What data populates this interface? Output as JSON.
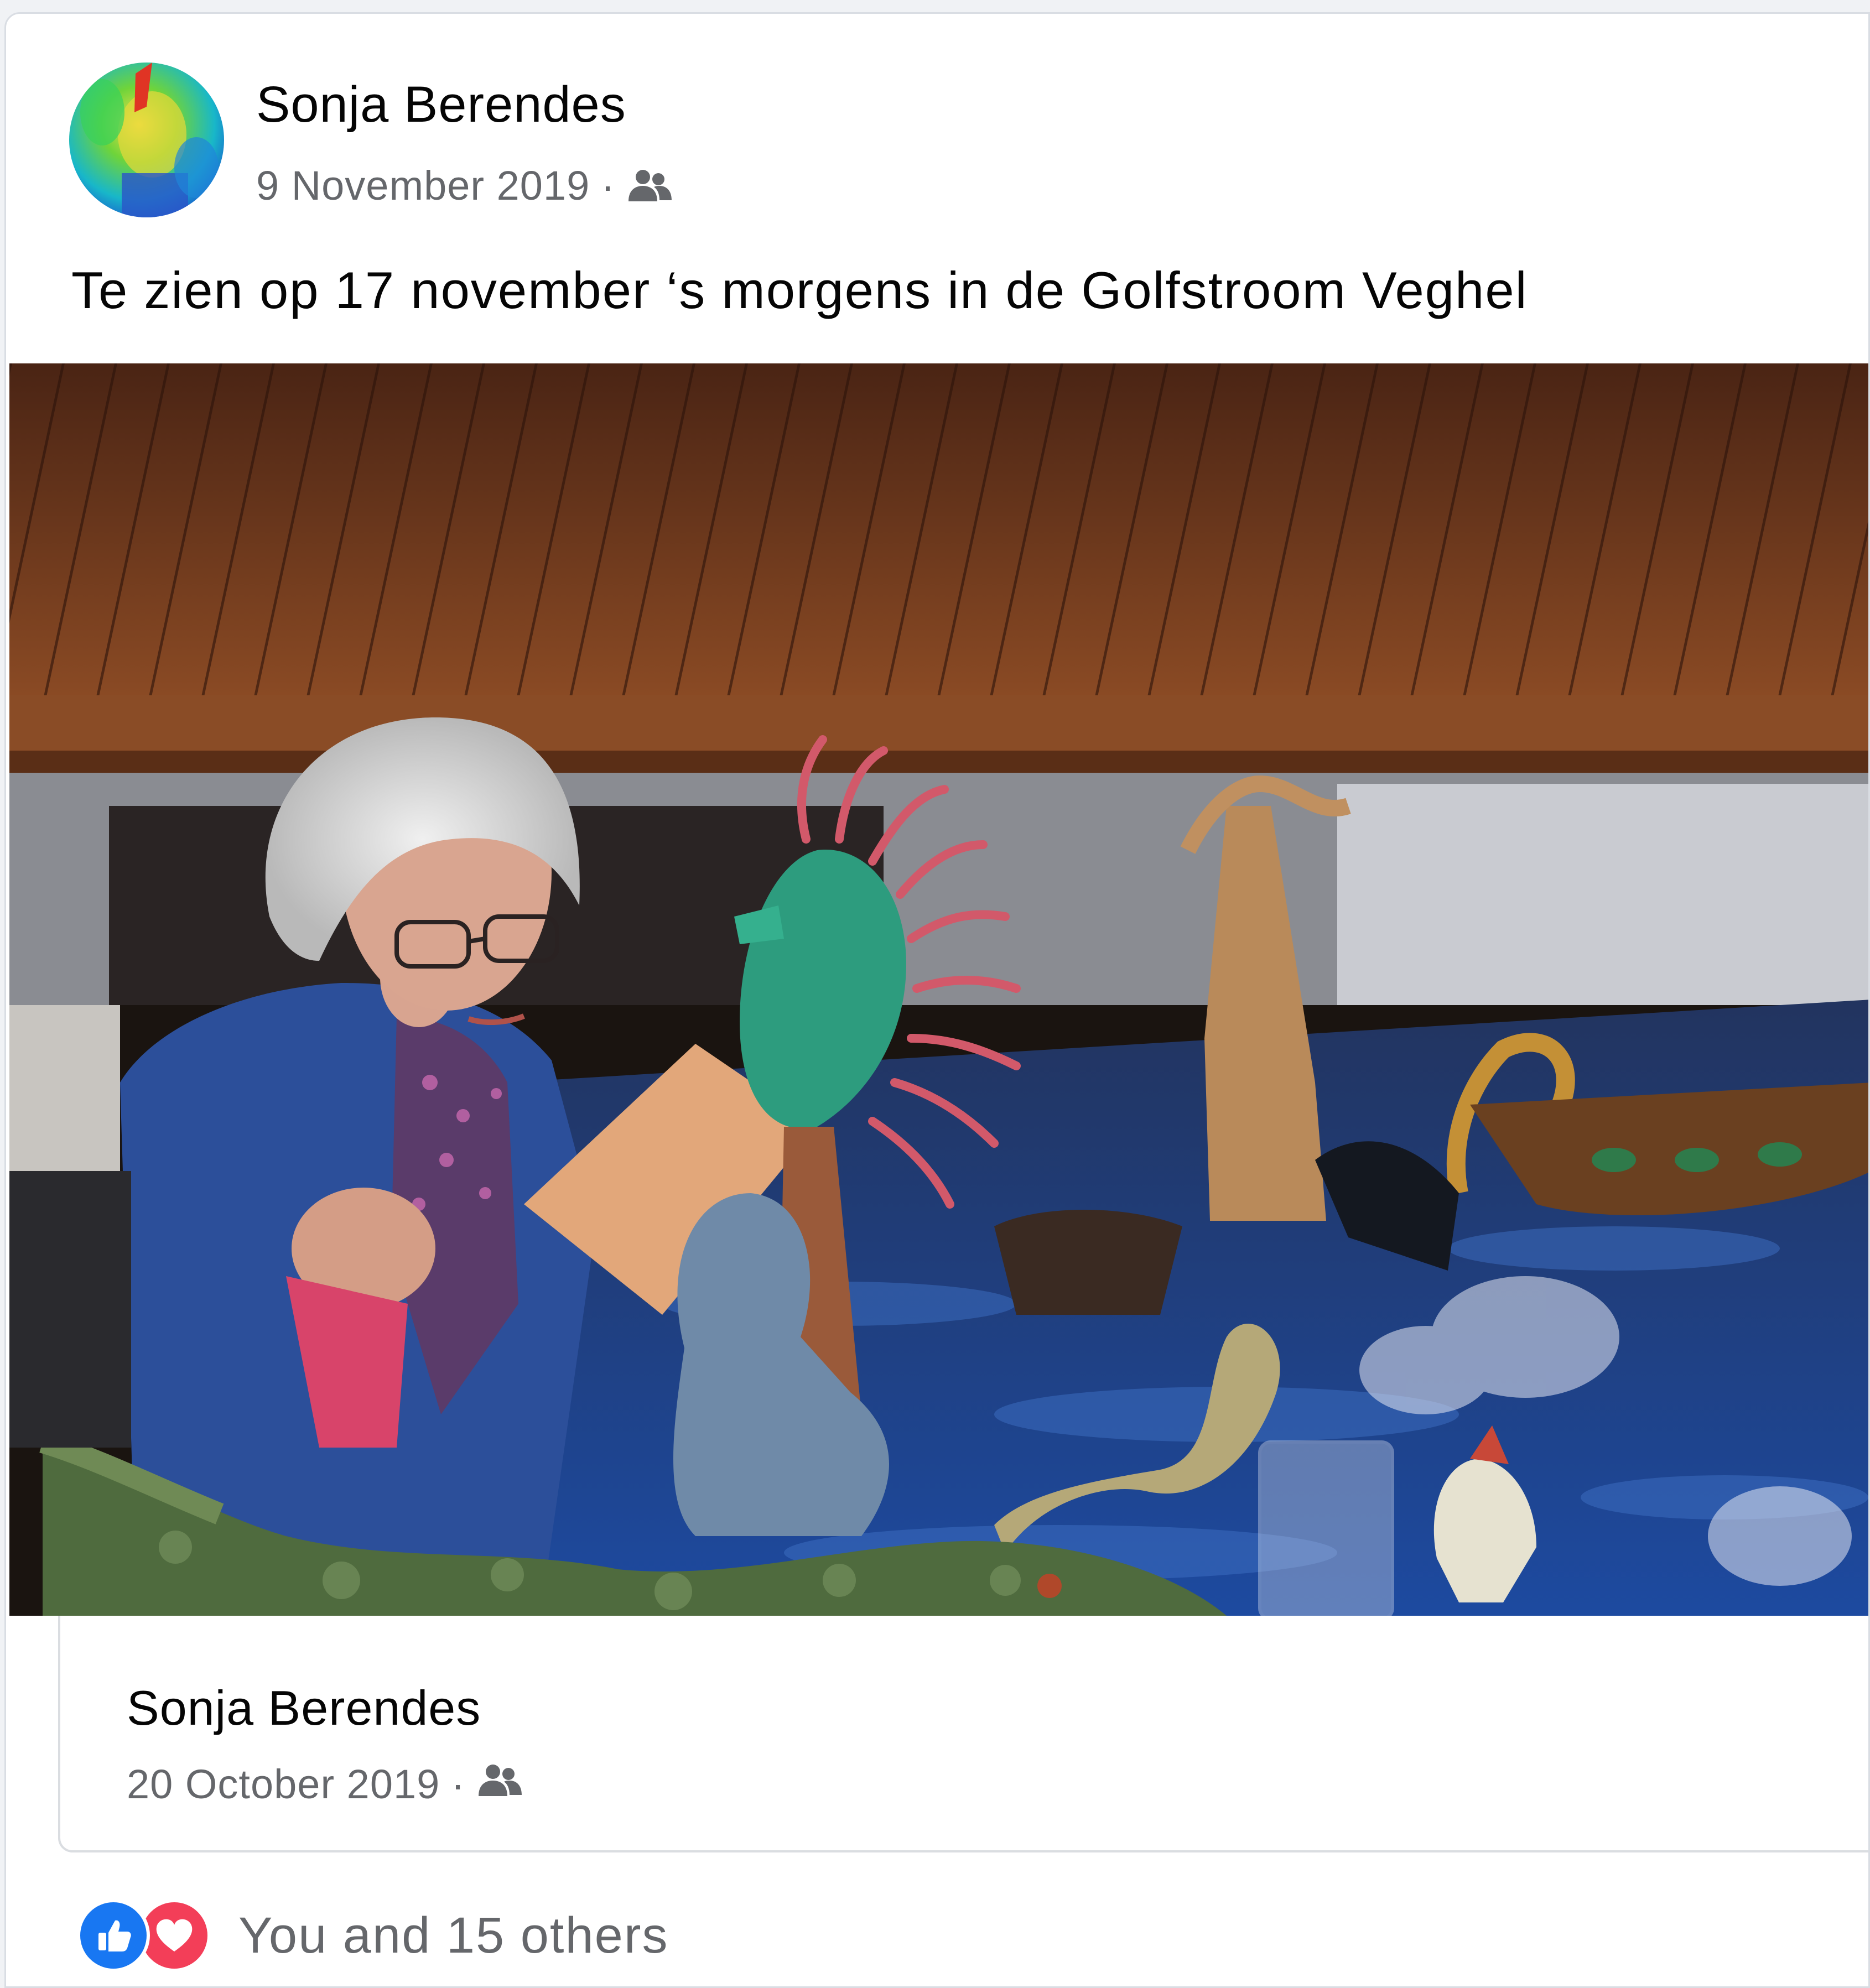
{
  "post": {
    "author": "Sonja Berendes",
    "date": "9 November 2019",
    "separator": "·",
    "audience_icon": "friends-icon",
    "text": "Te zien op 17 november ‘s morgens in de Golfstroom Veghel"
  },
  "shared_post": {
    "author": "Sonja Berendes",
    "date": "20 October 2019",
    "separator": "·",
    "audience_icon": "friends-icon"
  },
  "reactions": {
    "icons": [
      "like-icon",
      "love-icon"
    ],
    "summary": "You and 15 others"
  },
  "colors": {
    "like": "#1877f2",
    "love": "#f33e58",
    "secondary_text": "#65676b",
    "primary_text": "#050505"
  }
}
